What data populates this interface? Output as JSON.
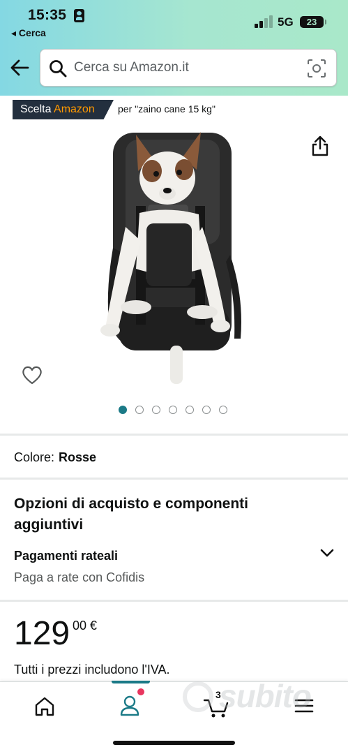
{
  "status_bar": {
    "time": "15:35",
    "back_app": "◂ Cerca",
    "network": "5G",
    "battery": "23"
  },
  "search": {
    "placeholder": "Cerca su Amazon.it"
  },
  "badge": {
    "prefix": "Scelta ",
    "brand": "Amazon",
    "query": "per \"zaino cane 15 kg\""
  },
  "carousel": {
    "total": 7,
    "active_index": 0
  },
  "color": {
    "label": "Colore:",
    "value": "Rosse"
  },
  "options": {
    "title": "Opzioni di acquisto e componenti aggiuntivi",
    "payment_title": "Pagamenti rateali",
    "payment_subtitle": "Paga a rate con Cofidis"
  },
  "price": {
    "main": "129",
    "cents": "00 €",
    "vat_note": "Tutti i prezzi includono l'IVA."
  },
  "bottom_nav": {
    "items": [
      "home-icon",
      "account-icon",
      "cart-icon",
      "menu-icon"
    ],
    "active": "account-icon",
    "cart_count": "3"
  },
  "watermark": "subito",
  "colors": {
    "header_start": "#84d8e3",
    "header_end": "#a9e8c9",
    "accent_teal": "#1b7a87",
    "amazon_orange": "#ff9900",
    "badge_bg": "#232f3e"
  }
}
